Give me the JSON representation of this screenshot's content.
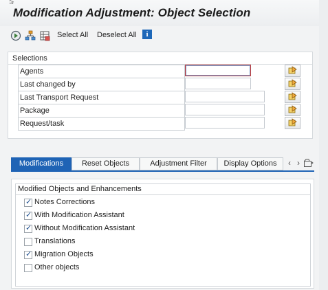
{
  "title": "Modification Adjustment: Object Selection",
  "toolbar": {
    "select_all": "Select All",
    "deselect_all": "Deselect All",
    "info": "i"
  },
  "selections": {
    "title": "Selections",
    "rows": [
      {
        "label": "Agents",
        "value": ""
      },
      {
        "label": "Last changed by",
        "value": ""
      },
      {
        "label": "Last Transport Request",
        "value": ""
      },
      {
        "label": "Package",
        "value": ""
      },
      {
        "label": "Request/task",
        "value": ""
      }
    ]
  },
  "tabs": {
    "items": [
      "Modifications",
      "Reset Objects",
      "Adjustment Filter",
      "Display Options"
    ],
    "active": "Modifications",
    "prev": "‹",
    "next": "›"
  },
  "modifications": {
    "title": "Modified Objects and Enhancements",
    "options": [
      {
        "label": "Notes Corrections",
        "checked": true
      },
      {
        "label": "With Modification Assistant",
        "checked": true
      },
      {
        "label": "Without Modification Assistant",
        "checked": true
      },
      {
        "label": "Translations",
        "checked": false
      },
      {
        "label": "Migration Objects",
        "checked": true
      },
      {
        "label": "Other objects",
        "checked": false
      }
    ]
  },
  "colors": {
    "accent": "#1f63b5",
    "background": "#f2f3f4",
    "panel": "#ffffff"
  },
  "icons": [
    "execute-icon",
    "tree-icon",
    "variant-icon",
    "info-icon",
    "multiple-selection-icon",
    "tab-overflow-icon"
  ]
}
